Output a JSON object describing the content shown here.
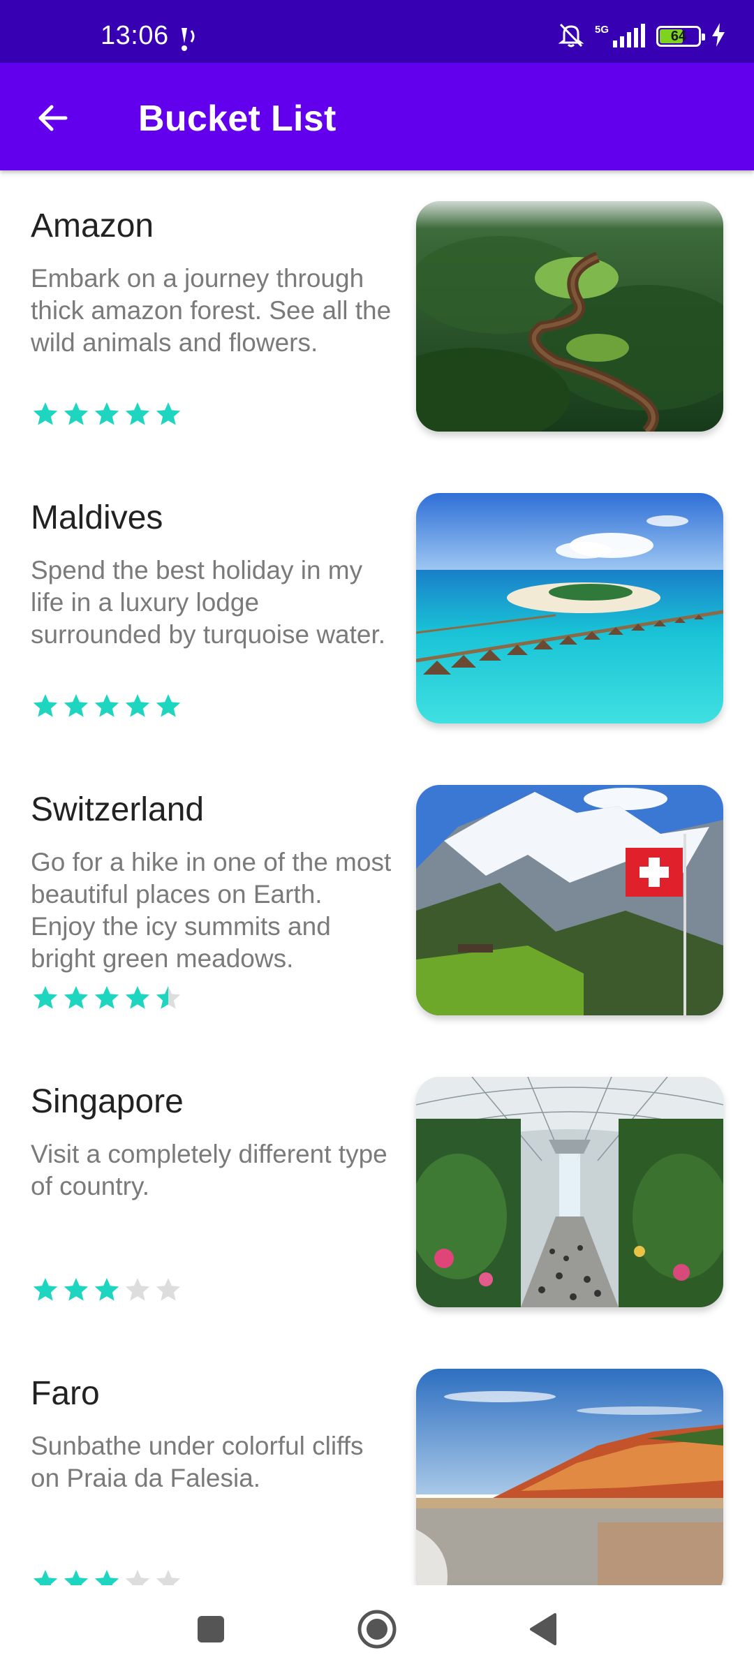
{
  "status_bar": {
    "time": "13:06",
    "battery_level": "64",
    "network": "5G",
    "icons": [
      "vibrate-icon",
      "bell-off-icon",
      "signal-icon",
      "battery-icon",
      "charging-icon"
    ]
  },
  "app_bar": {
    "title": "Bucket List",
    "back_icon": "arrow-back-icon",
    "color": "#6200ee",
    "status_color": "#3700b3"
  },
  "rating_colors": {
    "filled": "#1ed6c0",
    "empty": "#dddddd"
  },
  "items": [
    {
      "title": "Amazon",
      "description": "Embark on a journey through thick amazon forest. See all the wild animals and flowers.",
      "rating": 5,
      "image": "amazon-river-photo"
    },
    {
      "title": "Maldives",
      "description": "Spend the best holiday in my life in a luxury lodge surrounded by turquoise water.",
      "rating": 5,
      "image": "maldives-resort-photo"
    },
    {
      "title": "Switzerland",
      "description": "Go for a hike in one of the most beautiful places on Earth. Enjoy the icy summits and bright green meadows.",
      "rating": 4.5,
      "image": "swiss-alps-photo"
    },
    {
      "title": "Singapore",
      "description": "Visit a completely different type of country.",
      "rating": 3,
      "image": "singapore-jewel-photo"
    },
    {
      "title": "Faro",
      "description": "Sunbathe under colorful cliffs on Praia da Falesia.",
      "rating": 3,
      "image": "faro-cliffs-photo"
    }
  ],
  "nav_bar": {
    "icons": [
      "recents-square-icon",
      "home-circle-icon",
      "back-triangle-icon"
    ]
  }
}
